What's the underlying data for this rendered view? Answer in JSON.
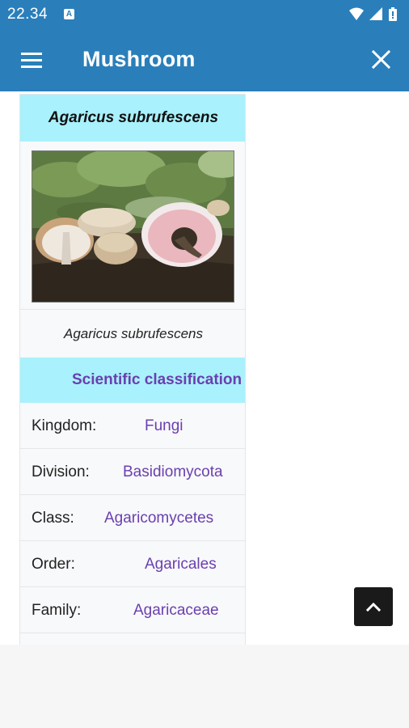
{
  "status_bar": {
    "time": "22.34",
    "notification_badge": "A",
    "icons": [
      "wifi-icon",
      "signal-icon",
      "battery-icon"
    ]
  },
  "app_bar": {
    "title": "Mushroom",
    "menu_icon": "hamburger-menu-icon",
    "close_icon": "close-icon"
  },
  "infobox": {
    "title": "Agaricus subrufescens",
    "image_caption": "Agaricus subrufescens",
    "section_header": "Scientific classification",
    "rows": [
      {
        "key": "Kingdom:",
        "value": "Fungi"
      },
      {
        "key": "Division:",
        "value": "Basidiomycota"
      },
      {
        "key": "Class:",
        "value": "Agaricomycetes"
      },
      {
        "key": "Order:",
        "value": "Agaricales"
      },
      {
        "key": "Family:",
        "value": "Agaricaceae"
      }
    ]
  },
  "scroll_top_icon": "chevron-up-icon",
  "colors": {
    "app_bar": "#2a7fba",
    "infobox_header": "#a9f1fc",
    "link": "#6a3fb0"
  }
}
